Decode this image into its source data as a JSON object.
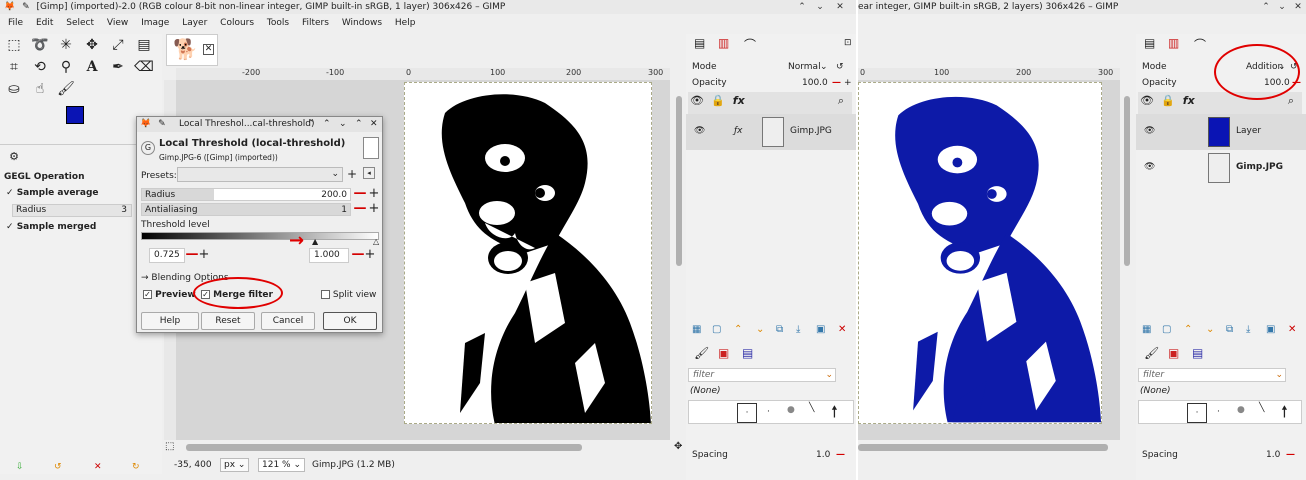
{
  "left": {
    "title": "[Gimp] (imported)-2.0 (RGB colour 8-bit non-linear integer, GIMP built-in sRGB, 1 layer) 306x426 – GIMP",
    "menu": [
      "File",
      "Edit",
      "Select",
      "View",
      "Image",
      "Layer",
      "Colours",
      "Tools",
      "Filters",
      "Windows",
      "Help"
    ],
    "tool_options": {
      "header": "GEGL Operation",
      "sample_average": "Sample average",
      "radius_label": "Radius",
      "radius_value": "3",
      "sample_merged": "Sample merged"
    },
    "ruler_ticks": [
      "-200",
      "-100",
      "0",
      "100",
      "200",
      "300"
    ],
    "status": {
      "coords": "-35, 400",
      "unit": "px",
      "zoom": "121 %",
      "info": "Gimp.JPG (1.2 MB)"
    },
    "layers_panel": {
      "mode_label": "Mode",
      "mode_value": "Normal",
      "opacity_label": "Opacity",
      "opacity_value": "100.0",
      "layer_name": "Gimp.JPG"
    },
    "brushes": {
      "filter_placeholder": "filter",
      "none_label": "(None)",
      "spacing_label": "Spacing",
      "spacing_value": "1.0"
    }
  },
  "dialog": {
    "title": "Local Threshol...cal-threshold)",
    "heading": "Local Threshold (local-threshold)",
    "subheading": "Gimp.JPG-6 ([Gimp] (imported))",
    "presets_label": "Presets:",
    "radius_label": "Radius",
    "radius_value": "200.0",
    "antialiasing_label": "Antialiasing",
    "antialiasing_value": "1",
    "threshold_label": "Threshold level",
    "low_value": "0.725",
    "high_value": "1.000",
    "blending_label": "Blending Options",
    "preview_label": "Preview",
    "merge_label": "Merge filter",
    "split_label": "Split view",
    "buttons": {
      "help": "Help",
      "reset": "Reset",
      "cancel": "Cancel",
      "ok": "OK"
    }
  },
  "right": {
    "title": "ear integer, GIMP built-in sRGB, 2 layers) 306x426 – GIMP",
    "ruler_ticks": [
      "0",
      "100",
      "200",
      "300"
    ],
    "layers_panel": {
      "mode_label": "Mode",
      "mode_value": "Addition",
      "opacity_label": "Opacity",
      "opacity_value": "100.0",
      "layers": [
        "Layer",
        "Gimp.JPG"
      ]
    },
    "brushes": {
      "filter_placeholder": "filter",
      "none_label": "(None)",
      "spacing_label": "Spacing",
      "spacing_value": "1.0"
    }
  },
  "colors": {
    "fg": "#0a14b4",
    "annotation": "#e00000",
    "blue_dog": "#0d1aa8"
  }
}
